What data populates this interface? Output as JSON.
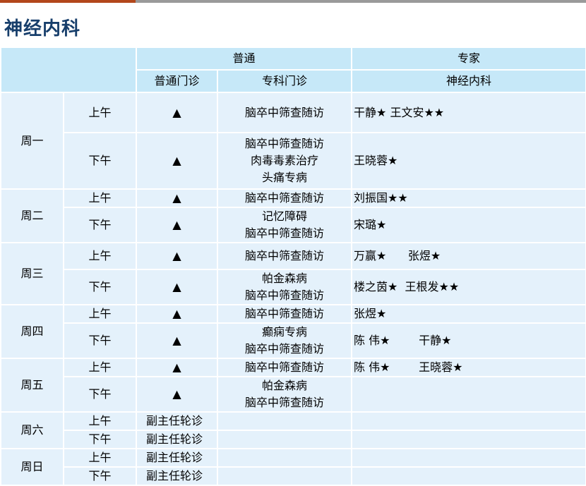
{
  "page": {
    "title": "神经内科"
  },
  "colors": {
    "title": "#173e6b",
    "header_bg": "#c6e8f8",
    "cell_bg": "#e4f1fb",
    "accent": "#b3471b"
  },
  "header": {
    "group_general": "普通",
    "group_expert": "专家",
    "col_general_clinic": "普通门诊",
    "col_special_clinic": "专科门诊",
    "col_expert_dept": "神经内科"
  },
  "schedule": [
    {
      "day": "周一",
      "sessions": [
        {
          "period": "上午",
          "general": "▲",
          "special": [
            "脑卒中筛查随访"
          ],
          "experts": "干静★ 王文安★★"
        },
        {
          "period": "下午",
          "general": "▲",
          "special": [
            "脑卒中筛查随访",
            "肉毒毒素治疗",
            "头痛专病"
          ],
          "experts": "王晓蓉★"
        }
      ]
    },
    {
      "day": "周二",
      "sessions": [
        {
          "period": "上午",
          "general": "▲",
          "special": [
            "脑卒中筛查随访"
          ],
          "experts": "刘振国★★"
        },
        {
          "period": "下午",
          "general": "▲",
          "special": [
            "记忆障碍",
            "脑卒中筛查随访"
          ],
          "experts": "宋璐★"
        }
      ]
    },
    {
      "day": "周三",
      "sessions": [
        {
          "period": "上午",
          "general": "▲",
          "special": [
            "脑卒中筛查随访"
          ],
          "experts": "万赢★      张煜★"
        },
        {
          "period": "下午",
          "general": "▲",
          "special": [
            "帕金森病",
            "脑卒中筛查随访"
          ],
          "experts": "楼之茵★  王根发★★"
        }
      ]
    },
    {
      "day": "周四",
      "sessions": [
        {
          "period": "上午",
          "general": "▲",
          "special": [
            "脑卒中筛查随访"
          ],
          "experts": "张煜★"
        },
        {
          "period": "下午",
          "general": "▲",
          "special": [
            "癫痫专病",
            "脑卒中筛查随访"
          ],
          "experts": "陈 伟★        干静★"
        }
      ]
    },
    {
      "day": "周五",
      "sessions": [
        {
          "period": "上午",
          "general": "▲",
          "special": [
            "脑卒中筛查随访"
          ],
          "experts": "陈 伟★        王晓蓉★"
        },
        {
          "period": "下午",
          "general": "▲",
          "special": [
            "帕金森病",
            "脑卒中筛查随访"
          ],
          "experts": ""
        }
      ]
    },
    {
      "day": "周六",
      "sessions": [
        {
          "period": "上午",
          "general": "副主任轮诊",
          "special": [],
          "experts": ""
        },
        {
          "period": "下午",
          "general": "副主任轮诊",
          "special": [],
          "experts": ""
        }
      ]
    },
    {
      "day": "周日",
      "sessions": [
        {
          "period": "上午",
          "general": "副主任轮诊",
          "special": [],
          "experts": ""
        },
        {
          "period": "下午",
          "general": "副主任轮诊",
          "special": [],
          "experts": ""
        }
      ]
    }
  ]
}
